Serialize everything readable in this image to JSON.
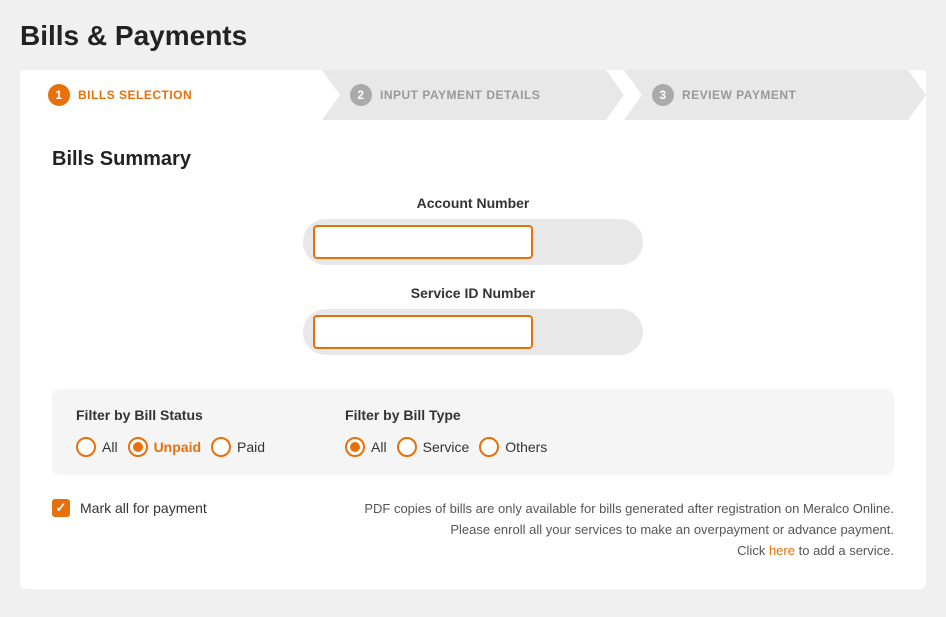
{
  "page": {
    "title": "Bills & Payments"
  },
  "steps": [
    {
      "id": "step-1",
      "number": "1",
      "label": "BILLS SELECTION",
      "active": true
    },
    {
      "id": "step-2",
      "number": "2",
      "label": "INPUT PAYMENT DETAILS",
      "active": false
    },
    {
      "id": "step-3",
      "number": "3",
      "label": "REVIEW PAYMENT",
      "active": false
    }
  ],
  "summary": {
    "title": "Bills Summary",
    "account_number_label": "Account Number",
    "account_number_placeholder": "",
    "service_id_label": "Service ID Number",
    "service_id_placeholder": ""
  },
  "filter_status": {
    "label": "Filter by Bill Status",
    "options": [
      {
        "id": "status-all",
        "label": "All",
        "checked": false
      },
      {
        "id": "status-unpaid",
        "label": "Unpaid",
        "checked": true,
        "orange": true
      },
      {
        "id": "status-paid",
        "label": "Paid",
        "checked": false
      }
    ]
  },
  "filter_type": {
    "label": "Filter by Bill Type",
    "options": [
      {
        "id": "type-all",
        "label": "All",
        "checked": true
      },
      {
        "id": "type-service",
        "label": "Service",
        "checked": false
      },
      {
        "id": "type-others",
        "label": "Others",
        "checked": false
      }
    ]
  },
  "bottom": {
    "mark_all_label": "Mark all for payment",
    "pdf_notice_line1": "PDF copies of bills are only available for bills generated after registration on Meralco Online.",
    "pdf_notice_line2": "Please enroll all your services to make an overpayment or advance payment.",
    "pdf_notice_line3": "Click",
    "pdf_notice_link": "here",
    "pdf_notice_line4": "to add a service."
  }
}
